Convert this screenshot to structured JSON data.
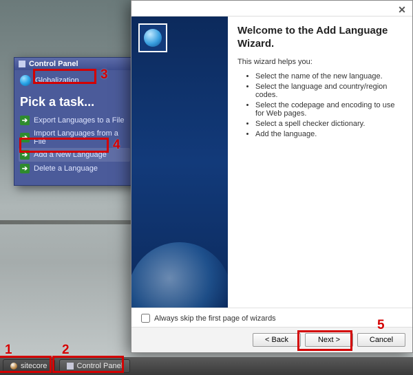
{
  "control_panel": {
    "title": "Control Panel",
    "sublink": "Globalization",
    "heading": "Pick a task...",
    "tasks": [
      "Export Languages to a File",
      "Import Languages from a File",
      "Add a New Language",
      "Delete a Language"
    ]
  },
  "wizard": {
    "title": "Welcome to the Add Language Wizard.",
    "intro": "This wizard helps you:",
    "bullets": [
      "Select the name of the new language.",
      "Select the language and country/region codes.",
      "Select the codepage and encoding to use for Web pages.",
      "Select a spell checker dictionary.",
      "Add the language."
    ],
    "skip_label": "Always skip the first page of wizards",
    "buttons": {
      "back": "< Back",
      "next": "Next >",
      "cancel": "Cancel"
    },
    "close": "✕"
  },
  "taskbar": {
    "start": "sitecore",
    "control_panel": "Control Panel"
  },
  "annotations": {
    "n1": "1",
    "n2": "2",
    "n3": "3",
    "n4": "4",
    "n5": "5"
  }
}
